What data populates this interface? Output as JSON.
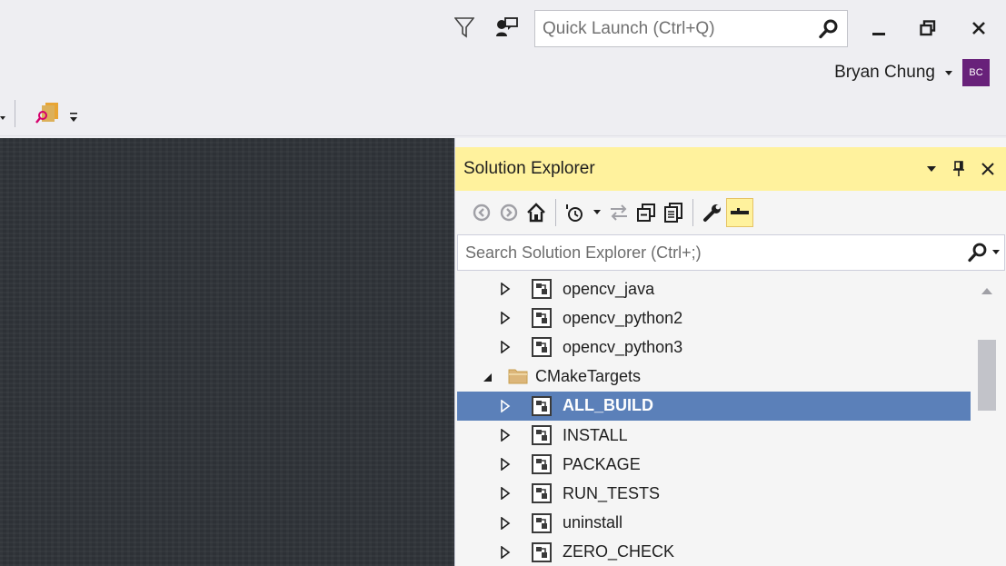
{
  "titlebar": {
    "quick_launch_placeholder": "Quick Launch (Ctrl+Q)",
    "user_name": "Bryan Chung",
    "avatar_initials": "BC"
  },
  "solution_explorer": {
    "title": "Solution Explorer",
    "search_placeholder": "Search Solution Explorer (Ctrl+;)",
    "items": [
      {
        "label": "opencv_java",
        "level": 2,
        "expander": "collapsed",
        "icon": "project-icon",
        "selected": false
      },
      {
        "label": "opencv_python2",
        "level": 2,
        "expander": "collapsed",
        "icon": "project-icon",
        "selected": false
      },
      {
        "label": "opencv_python3",
        "level": 2,
        "expander": "collapsed",
        "icon": "project-icon",
        "selected": false
      },
      {
        "label": "CMakeTargets",
        "level": 1,
        "expander": "expanded",
        "icon": "folder-icon",
        "selected": false
      },
      {
        "label": "ALL_BUILD",
        "level": 2,
        "expander": "collapsed",
        "icon": "project-icon",
        "selected": true
      },
      {
        "label": "INSTALL",
        "level": 2,
        "expander": "collapsed",
        "icon": "project-icon",
        "selected": false
      },
      {
        "label": "PACKAGE",
        "level": 2,
        "expander": "collapsed",
        "icon": "project-icon",
        "selected": false
      },
      {
        "label": "RUN_TESTS",
        "level": 2,
        "expander": "collapsed",
        "icon": "project-icon",
        "selected": false
      },
      {
        "label": "uninstall",
        "level": 2,
        "expander": "collapsed",
        "icon": "project-icon",
        "selected": false
      },
      {
        "label": "ZERO_CHECK",
        "level": 2,
        "expander": "collapsed",
        "icon": "project-icon",
        "selected": false
      }
    ]
  },
  "colors": {
    "chrome_bg": "#eeeef2",
    "panel_header_active": "#fff29d",
    "selection": "#5b80b9",
    "editor_bg": "#2f3338",
    "avatar_bg": "#68217a"
  }
}
